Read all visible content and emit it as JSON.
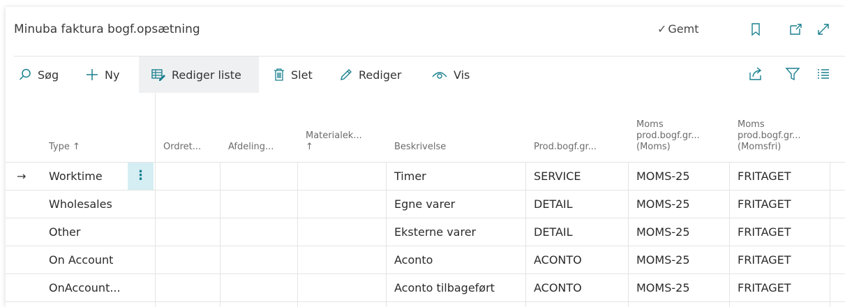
{
  "header": {
    "title": "Minuba faktura bogf.opsætning",
    "saved_label": "Gemt",
    "icons": [
      "bookmark-icon",
      "open-in-new-window-icon",
      "expand-icon"
    ]
  },
  "toolbar": {
    "search_label": "Søg",
    "new_label": "Ny",
    "edit_list_label": "Rediger liste",
    "delete_label": "Slet",
    "edit_label": "Rediger",
    "view_label": "Vis",
    "right_icons": [
      "share-icon",
      "filter-icon",
      "list-view-icon"
    ]
  },
  "columns": [
    {
      "lines": [
        "Type ↑"
      ]
    },
    {
      "lines": [
        "Ordret..."
      ]
    },
    {
      "lines": [
        "Afdeling..."
      ]
    },
    {
      "lines": [
        "Materialek...",
        "↑"
      ]
    },
    {
      "lines": [
        "Beskrivelse"
      ]
    },
    {
      "lines": [
        "Prod.bogf.gr..."
      ]
    },
    {
      "lines": [
        "Moms",
        "prod.bogf.gr...",
        "(Moms)"
      ]
    },
    {
      "lines": [
        "Moms",
        "prod.bogf.gr...",
        "(Momsfri)"
      ]
    }
  ],
  "rows": [
    {
      "type": "Worktime",
      "beskrivelse": "Timer",
      "prod": "SERVICE",
      "moms": "MOMS-25",
      "momsfri": "FRITAGET",
      "selected": true
    },
    {
      "type": "Wholesales",
      "beskrivelse": "Egne varer",
      "prod": "DETAIL",
      "moms": "MOMS-25",
      "momsfri": "FRITAGET"
    },
    {
      "type": "Other",
      "beskrivelse": "Eksterne varer",
      "prod": "DETAIL",
      "moms": "MOMS-25",
      "momsfri": "FRITAGET"
    },
    {
      "type": "On Account",
      "beskrivelse": "Aconto",
      "prod": "ACONTO",
      "moms": "MOMS-25",
      "momsfri": "FRITAGET"
    },
    {
      "type": "OnAccount...",
      "beskrivelse": "Aconto tilbageført",
      "prod": "ACONTO",
      "moms": "MOMS-25",
      "momsfri": "FRITAGET"
    }
  ],
  "row_indicator": "→",
  "row_menu_glyph": "⋮",
  "colors": {
    "accent": "#117f92",
    "selection": "#d5eef3",
    "toolbar_active": "#eef0f2"
  }
}
